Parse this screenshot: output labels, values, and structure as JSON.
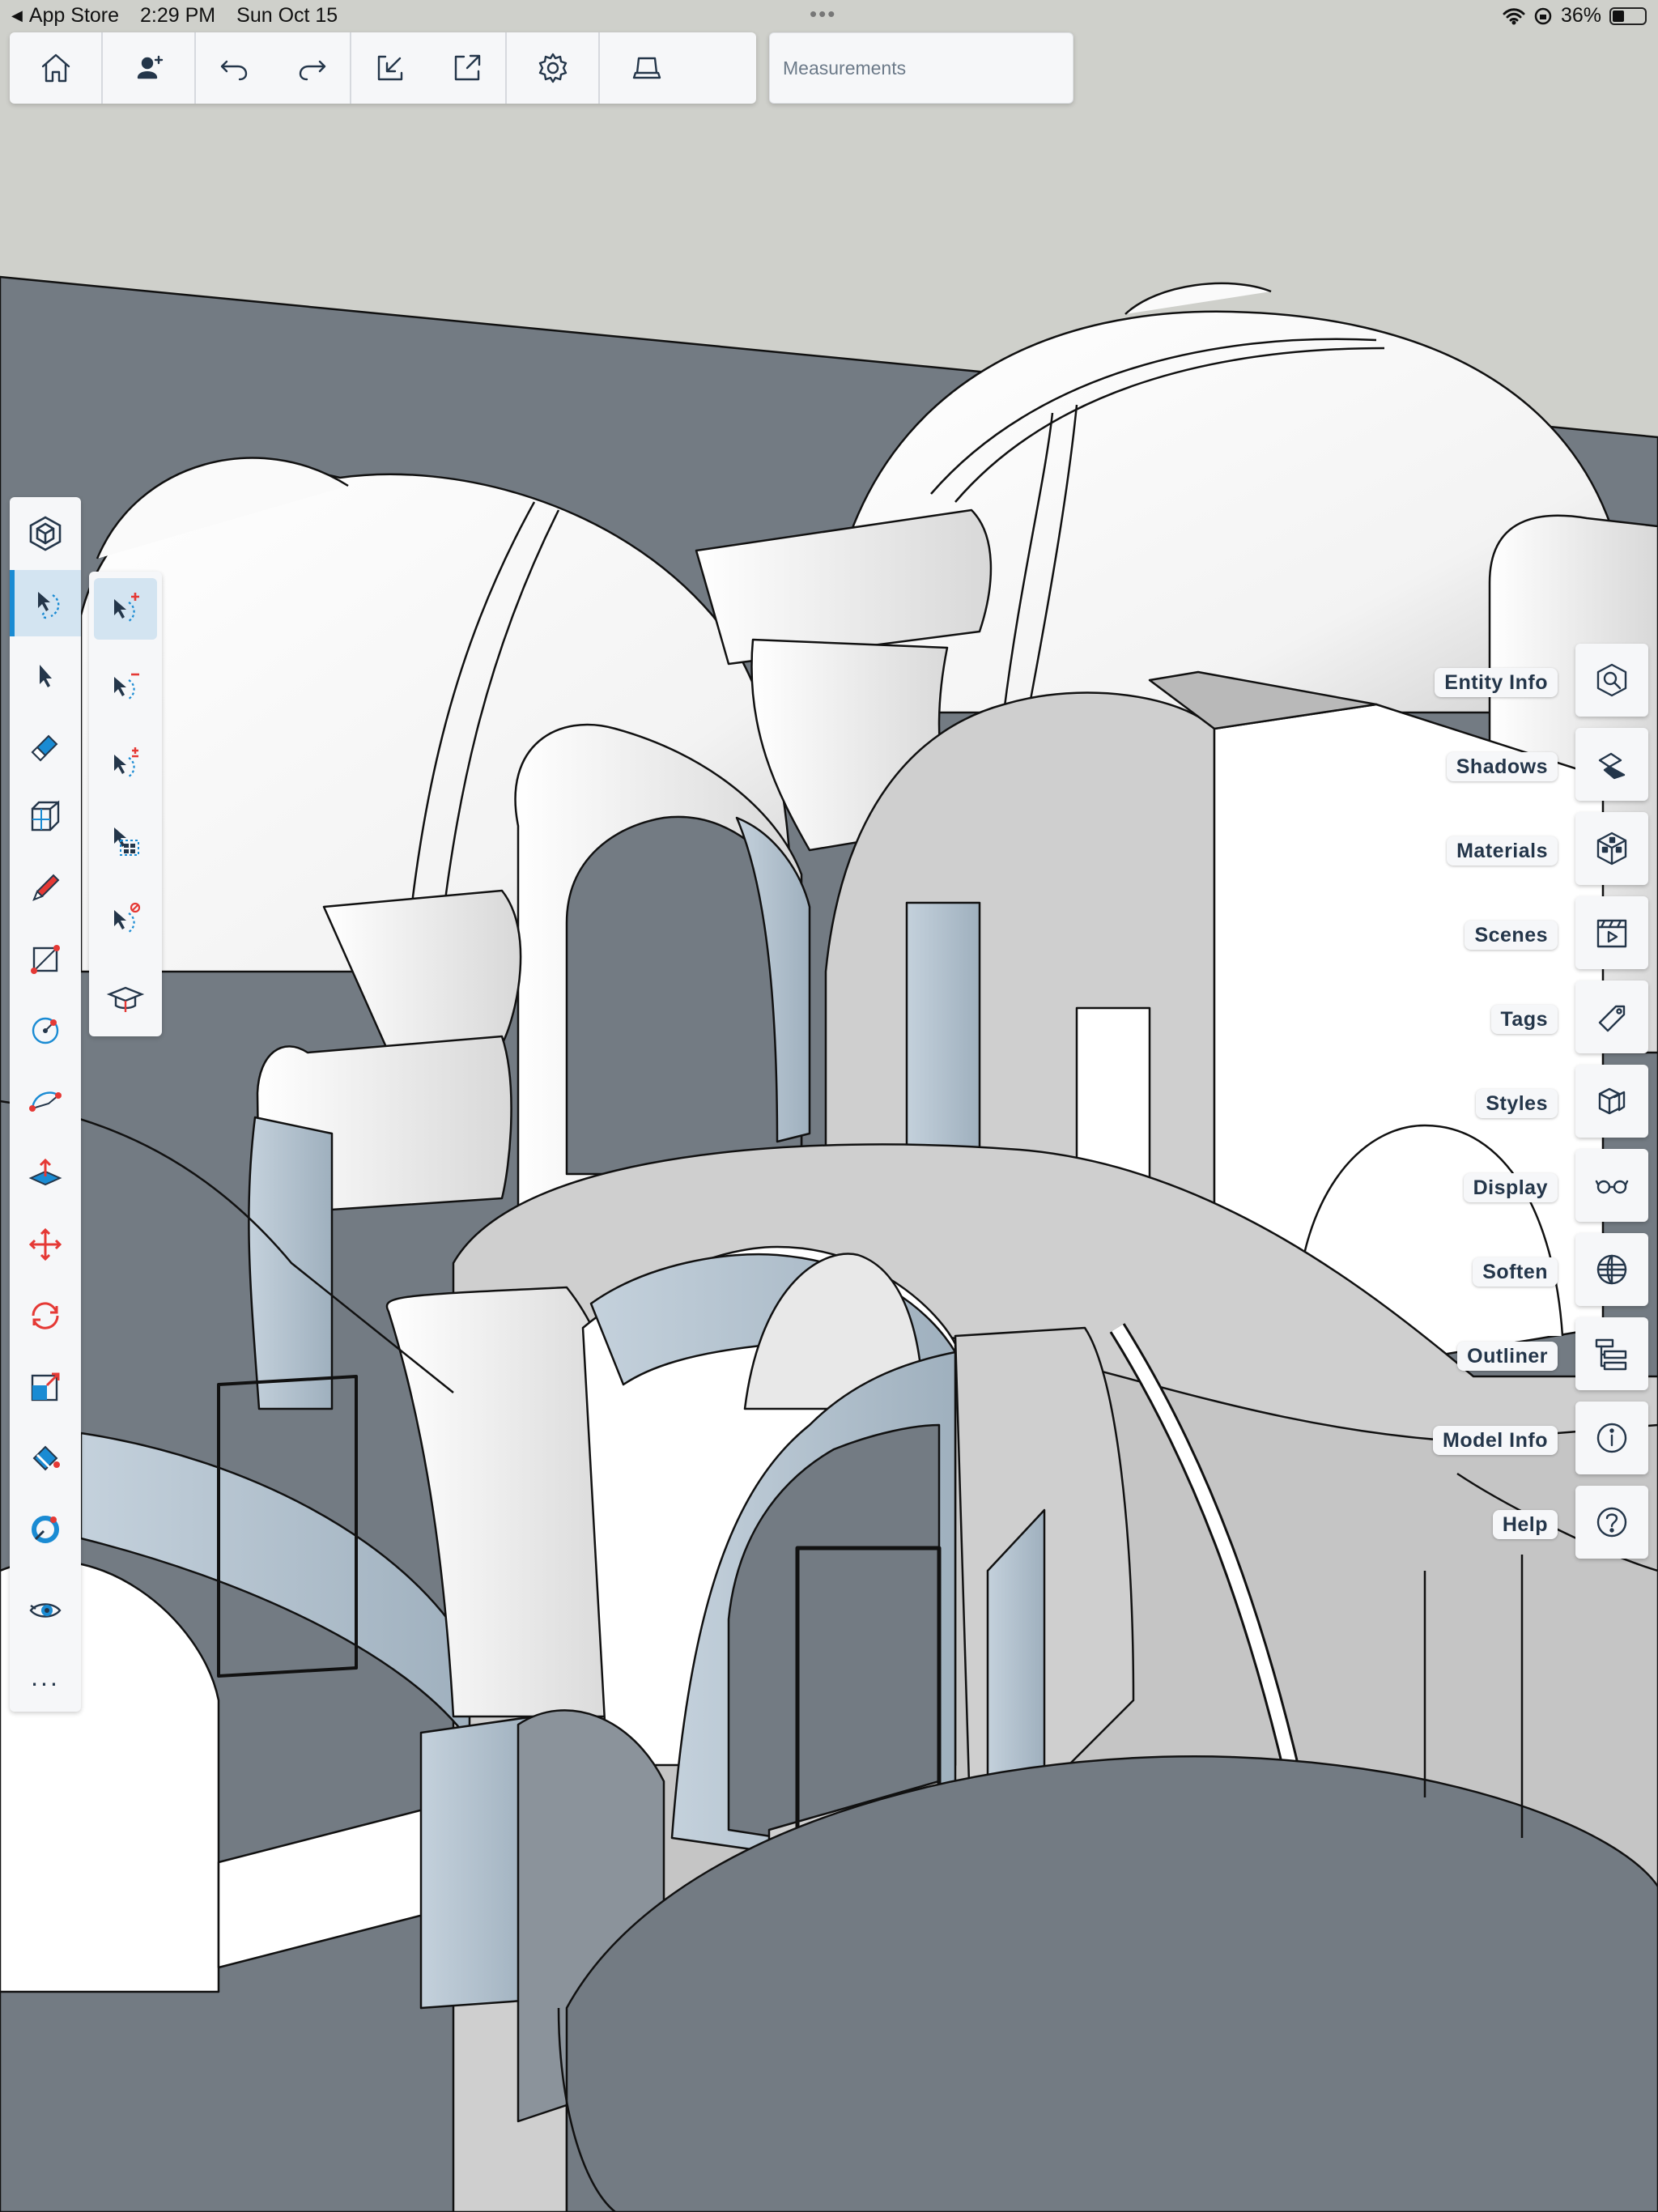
{
  "status_bar": {
    "back_app": "App Store",
    "time": "2:29 PM",
    "date": "Sun Oct 15",
    "battery_text": "36%",
    "battery_level": 0.36
  },
  "top_toolbar": {
    "measurements_label": "Measurements"
  },
  "right_panel": {
    "items": [
      {
        "label": "Entity Info"
      },
      {
        "label": "Shadows"
      },
      {
        "label": "Materials"
      },
      {
        "label": "Scenes"
      },
      {
        "label": "Tags"
      },
      {
        "label": "Styles"
      },
      {
        "label": "Display"
      },
      {
        "label": "Soften"
      },
      {
        "label": "Outliner"
      },
      {
        "label": "Model Info"
      },
      {
        "label": "Help"
      }
    ]
  },
  "left_toolbar": {
    "more_label": "..."
  },
  "colors": {
    "accent": "#1a8bd3",
    "icon": "#24364a",
    "sky": "#cfd0cb",
    "ground": "#737b83",
    "glass": "#b9c9d6"
  }
}
